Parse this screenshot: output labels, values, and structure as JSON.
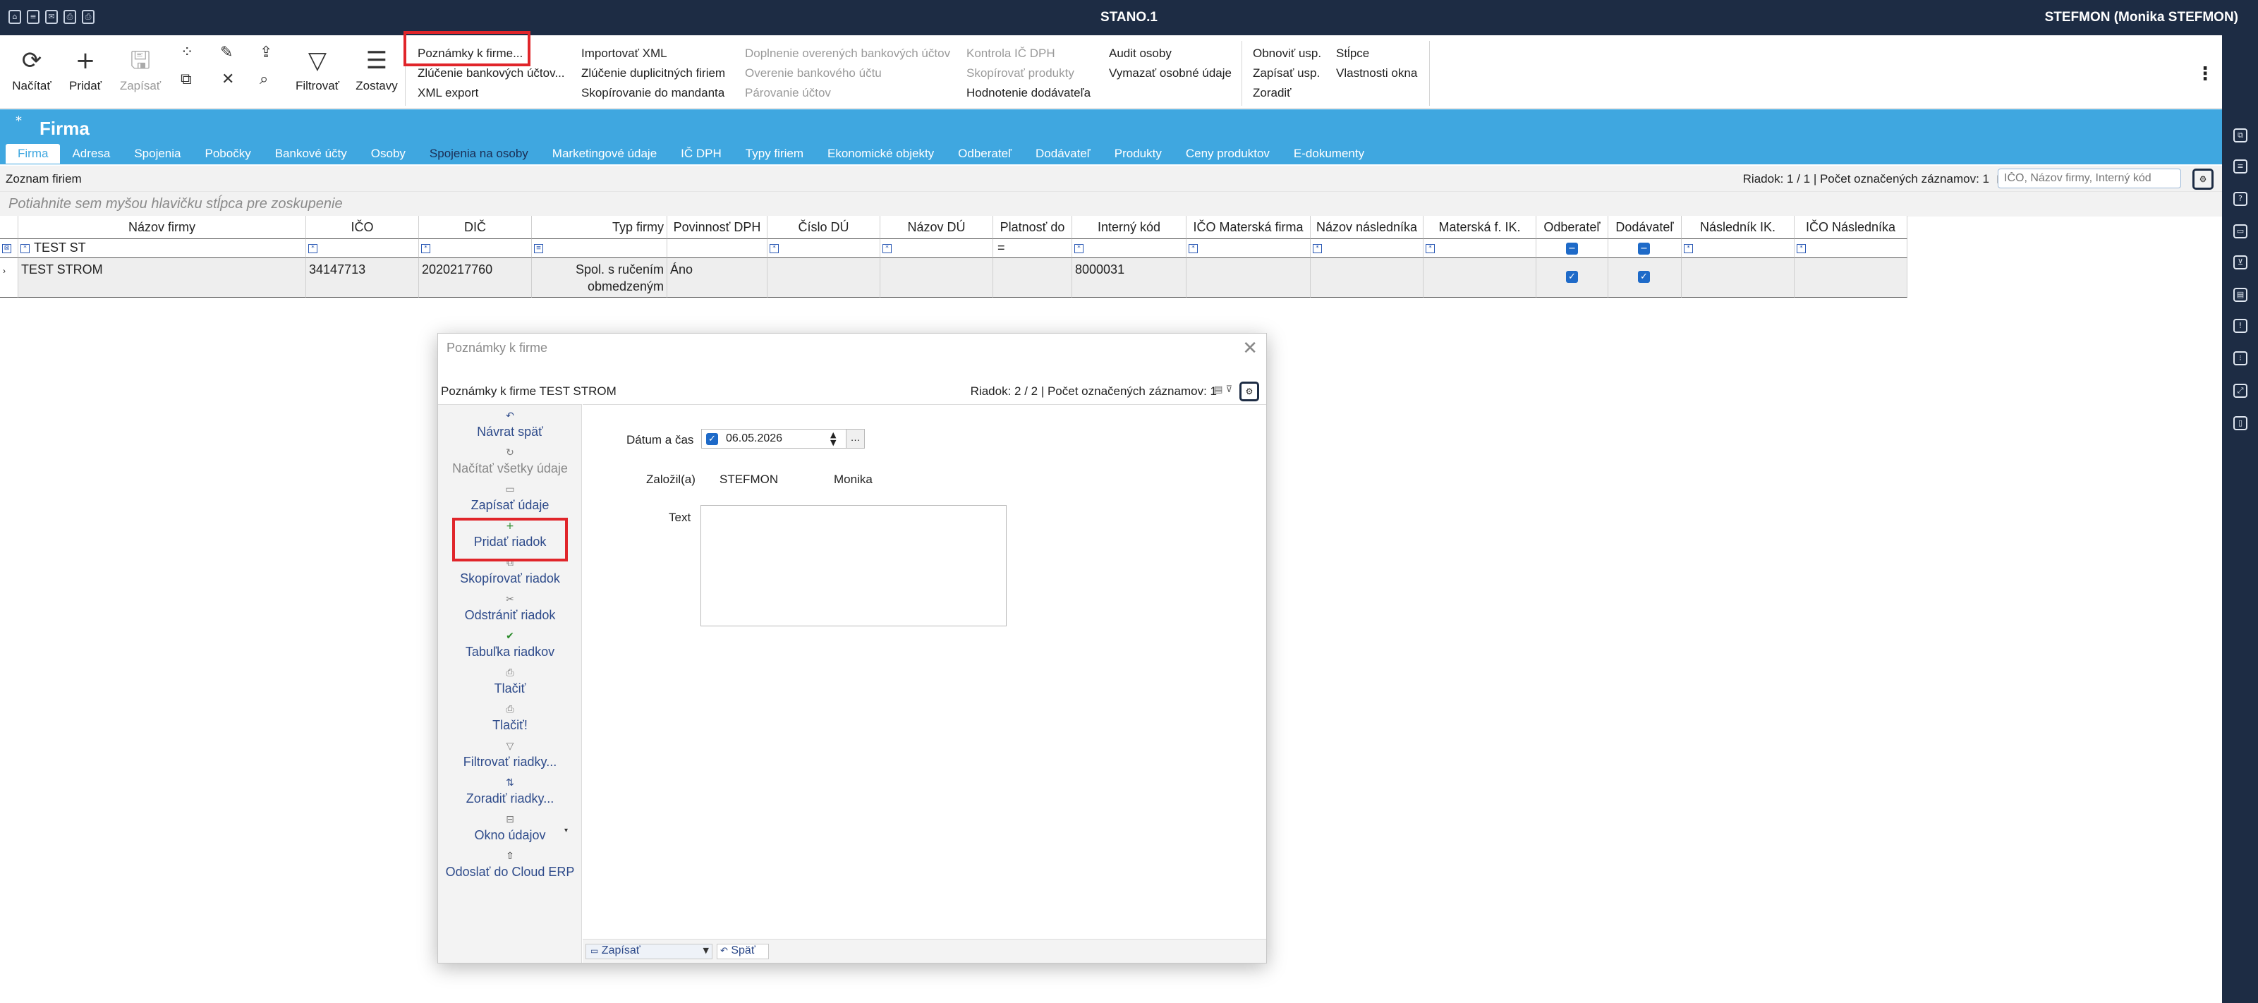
{
  "window": {
    "app_title": "STANO.1",
    "user": "STEFMON (Monika STEFMON)"
  },
  "toolbar": {
    "buttons": [
      {
        "label": "Načítať",
        "icon": "refresh-icon"
      },
      {
        "label": "Pridať",
        "icon": "plus-icon"
      },
      {
        "label": "Zapísať",
        "icon": "save-icon",
        "disabled": true
      },
      {
        "label": "Filtrovať",
        "icon": "filter-icon"
      },
      {
        "label": "Zostavy",
        "icon": "reports-icon"
      }
    ],
    "menu_col1": [
      "Poznámky k firme...",
      "Zlúčenie bankových účtov...",
      "XML export"
    ],
    "menu_col2": [
      "Importovať XML",
      "Zlúčenie duplicitných firiem",
      "Skopírovanie do mandanta"
    ],
    "menu_col3": [
      "Doplnenie overených bankových účtov",
      "Overenie bankového účtu",
      "Párovanie účtov"
    ],
    "menu_col4": [
      "Kontrola IČ DPH",
      "Skopírovať produkty",
      "Hodnotenie dodávateľa"
    ],
    "menu_col5": [
      "Audit osoby",
      "Vymazať osobné údaje"
    ],
    "menu_col6": [
      "Obnoviť usp.",
      "Zapísať usp.",
      "Zoradiť"
    ],
    "menu_col7": [
      "Stĺpce",
      "Vlastnosti okna"
    ]
  },
  "header": {
    "title": "Firma",
    "tabs": [
      "Firma",
      "Adresa",
      "Spojenia",
      "Pobočky",
      "Bankové účty",
      "Osoby",
      "Spojenia na osoby",
      "Marketingové údaje",
      "IČ DPH",
      "Typy firiem",
      "Ekonomické objekty",
      "Odberateľ",
      "Dodávateľ",
      "Produkty",
      "Ceny produktov",
      "E-dokumenty"
    ]
  },
  "list": {
    "title": "Zoznam firiem",
    "status": "Riadok: 1 / 1 | Počet označených záznamov: 1",
    "search_placeholder": "IČO, Názov firmy, Interný kód",
    "group_hint": "Potiahnite sem myšou hlavičku stĺpca pre zoskupenie",
    "columns": [
      "Názov firmy",
      "IČO",
      "DIČ",
      "Typ firmy",
      "Povinnosť DPH",
      "Číslo DÚ",
      "Názov DÚ",
      "Platnosť do",
      "Interný kód",
      "IČO Materská firma",
      "Názov následníka",
      "Materská f. IK.",
      "Odberateľ",
      "Dodávateľ",
      "Následník IK.",
      "IČO Následníka"
    ],
    "filter_name": "TEST ST",
    "filter_platnost": "=",
    "row": {
      "nazov": "TEST STROM",
      "ico": "34147713",
      "dic": "2020217760",
      "typ": "Spol. s ručením obmedzeným",
      "dph": "Áno",
      "interny_kod": "8000031"
    }
  },
  "dialog": {
    "title": "Poznámky k firme",
    "subtitle": "Poznámky k firme TEST STROM",
    "status": "Riadok: 2 / 2 | Počet označených záznamov: 1",
    "actions": [
      {
        "label": "Návrat späť",
        "icon": "undo-icon"
      },
      {
        "label": "Načítať všetky údaje",
        "icon": "reload-icon"
      },
      {
        "label": "Zapísať údaje",
        "icon": "save-icon"
      },
      {
        "label": "Pridať riadok",
        "icon": "plus-icon"
      },
      {
        "label": "Skopírovať riadok",
        "icon": "copy-icon"
      },
      {
        "label": "Odstrániť riadok",
        "icon": "delete-icon"
      },
      {
        "label": "Tabuľka riadkov",
        "icon": "check-icon"
      },
      {
        "label": "Tlačiť",
        "icon": "print-icon"
      },
      {
        "label": "Tlačiť!",
        "icon": "print-preview-icon"
      },
      {
        "label": "Filtrovať riadky...",
        "icon": "filter-icon"
      },
      {
        "label": "Zoradiť riadky...",
        "icon": "sort-icon"
      },
      {
        "label": "Okno údajov",
        "icon": "window-icon"
      },
      {
        "label": "Odoslať do Cloud ERP",
        "icon": "cloud-icon"
      }
    ],
    "form": {
      "datetime_label": "Dátum a čas",
      "datetime_value": "06.05.2026",
      "created_label": "Založil(a)",
      "created_user": "STEFMON",
      "created_name": "Monika",
      "text_label": "Text",
      "text_value": ""
    },
    "footer": {
      "save": "Zapísať",
      "undo": "Späť"
    }
  }
}
